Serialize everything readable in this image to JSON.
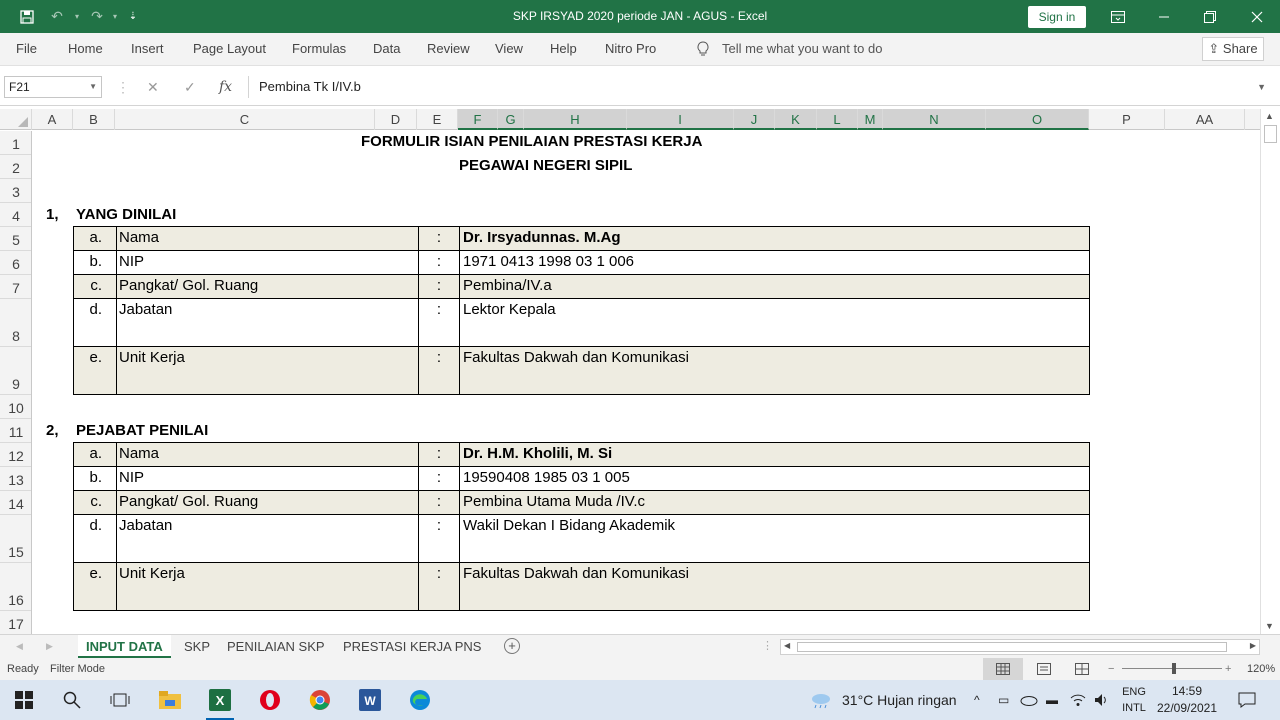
{
  "window": {
    "title": "SKP IRSYAD 2020 periode JAN - AGUS  -  Excel",
    "sign_in": "Sign in"
  },
  "ribbon": {
    "tabs": [
      "File",
      "Home",
      "Insert",
      "Page Layout",
      "Formulas",
      "Data",
      "Review",
      "View",
      "Help",
      "Nitro Pro"
    ],
    "tell_me": "Tell me what you want to do",
    "share": "Share"
  },
  "formula_bar": {
    "name_box": "F21",
    "formula": "Pembina Tk I/IV.b"
  },
  "columns": [
    "A",
    "B",
    "C",
    "D",
    "E",
    "F",
    "G",
    "H",
    "I",
    "J",
    "K",
    "L",
    "M",
    "N",
    "O",
    "P",
    "AA"
  ],
  "rows": [
    "1",
    "2",
    "3",
    "4",
    "5",
    "6",
    "7",
    "8",
    "9",
    "10",
    "11",
    "12",
    "13",
    "14",
    "15",
    "16",
    "17"
  ],
  "sheet": {
    "heading1": "FORMULIR ISIAN PENILAIAN PRESTASI KERJA",
    "heading2": "PEGAWAI NEGERI SIPIL",
    "section1": {
      "num": "1,",
      "title": "YANG DINILAI"
    },
    "section2": {
      "num": "2,",
      "title": "PEJABAT PENILAI"
    },
    "table1": [
      {
        "letter": "a.",
        "label": "Nama",
        "colon": ":",
        "value": "Dr. Irsyadunnas. M.Ag",
        "bold": true
      },
      {
        "letter": "b.",
        "label": "NIP",
        "colon": ":",
        "value": "1971 0413 1998 03 1 006",
        "bold": false
      },
      {
        "letter": "c.",
        "label": "Pangkat/ Gol. Ruang",
        "colon": ":",
        "value": "Pembina/IV.a",
        "bold": false
      },
      {
        "letter": "d.",
        "label": "Jabatan",
        "colon": ":",
        "value": "Lektor Kepala",
        "bold": false
      },
      {
        "letter": "e.",
        "label": "Unit Kerja",
        "colon": ":",
        "value": "Fakultas Dakwah dan Komunikasi",
        "bold": false
      }
    ],
    "table2": [
      {
        "letter": "a.",
        "label": "Nama",
        "colon": ":",
        "value": "Dr. H.M. Kholili, M. Si",
        "bold": true
      },
      {
        "letter": "b.",
        "label": "NIP",
        "colon": ":",
        "value": "19590408 1985 03 1 005",
        "bold": false
      },
      {
        "letter": "c.",
        "label": "Pangkat/ Gol. Ruang",
        "colon": ":",
        "value": "Pembina Utama Muda /IV.c",
        "bold": false
      },
      {
        "letter": "d.",
        "label": "Jabatan",
        "colon": ":",
        "value": "Wakil Dekan I Bidang Akademik",
        "bold": false
      },
      {
        "letter": "e.",
        "label": "Unit Kerja",
        "colon": ":",
        "value": "Fakultas Dakwah dan Komunikasi",
        "bold": false
      }
    ]
  },
  "sheet_tabs": [
    "INPUT DATA",
    "SKP",
    "PENILAIAN SKP",
    "PRESTASI KERJA PNS"
  ],
  "status": {
    "ready": "Ready",
    "filter": "Filter Mode",
    "zoom": "120%"
  },
  "taskbar": {
    "weather": "31°C  Hujan ringan",
    "lang1": "ENG",
    "lang2": "INTL",
    "time": "14:59",
    "date": "22/09/2021"
  },
  "colors": {
    "excel_green": "#217346",
    "shaded_row": "#eeece1"
  }
}
